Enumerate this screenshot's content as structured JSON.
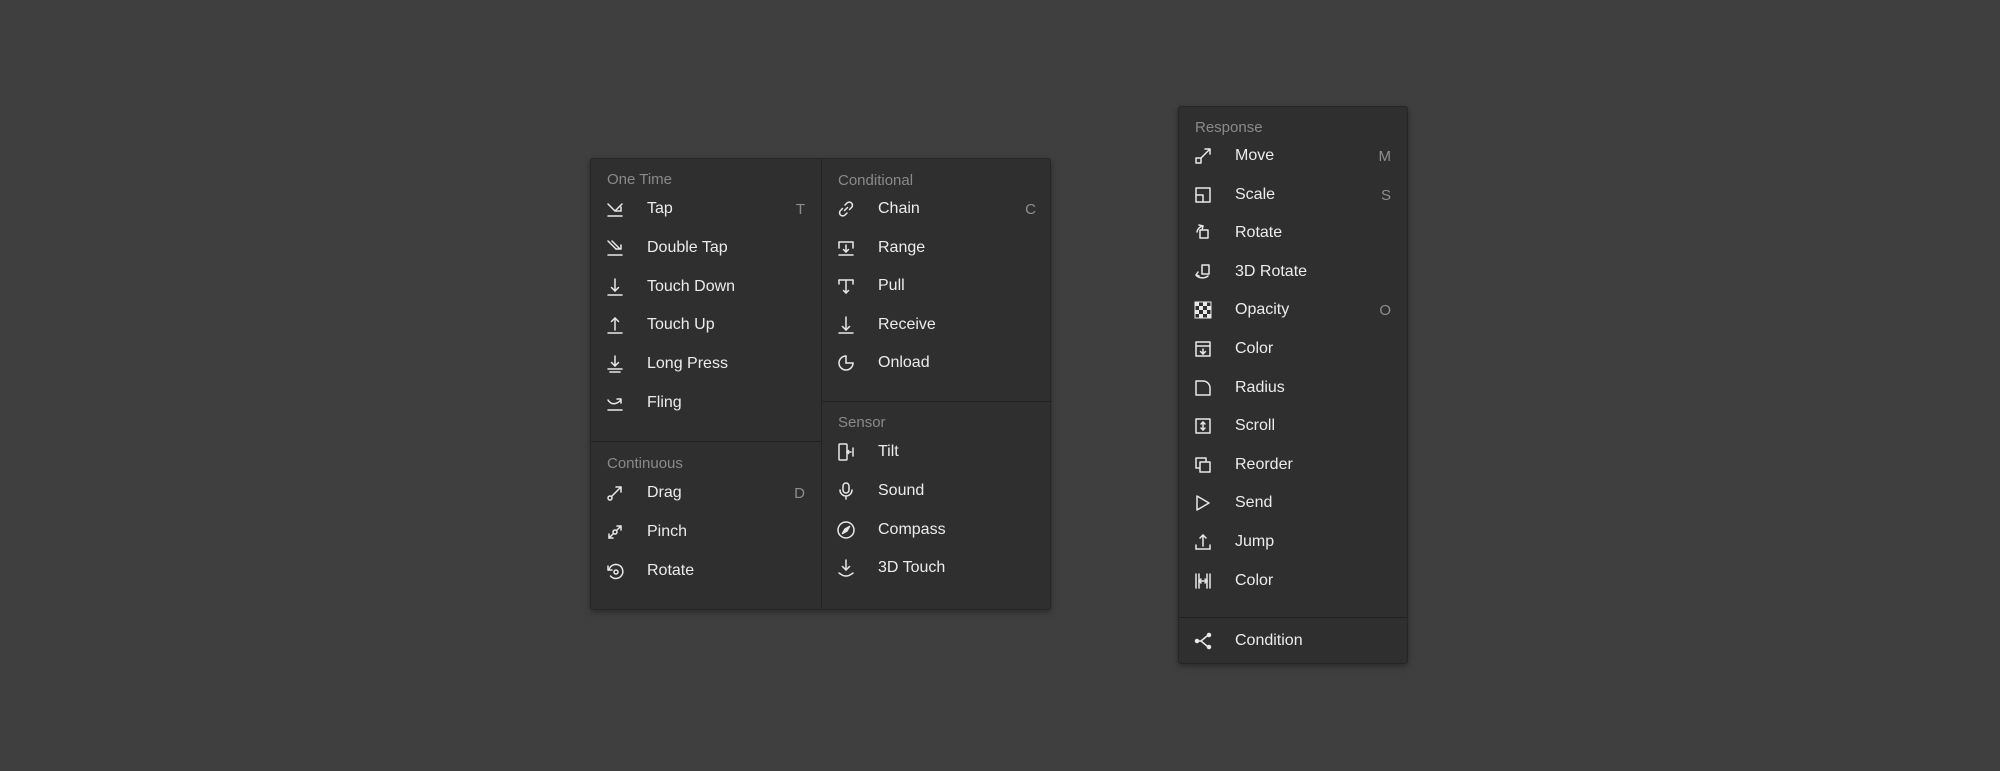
{
  "trigger_panel": {
    "one_time": {
      "title": "One Time",
      "items": [
        {
          "label": "Tap",
          "shortcut": "T",
          "icon": "tap-icon"
        },
        {
          "label": "Double Tap",
          "shortcut": "",
          "icon": "double-tap-icon"
        },
        {
          "label": "Touch Down",
          "shortcut": "",
          "icon": "touch-down-icon"
        },
        {
          "label": "Touch Up",
          "shortcut": "",
          "icon": "touch-up-icon"
        },
        {
          "label": "Long Press",
          "shortcut": "",
          "icon": "long-press-icon"
        },
        {
          "label": "Fling",
          "shortcut": "",
          "icon": "fling-icon"
        }
      ]
    },
    "continuous": {
      "title": "Continuous",
      "items": [
        {
          "label": "Drag",
          "shortcut": "D",
          "icon": "drag-icon"
        },
        {
          "label": "Pinch",
          "shortcut": "",
          "icon": "pinch-icon"
        },
        {
          "label": "Rotate",
          "shortcut": "",
          "icon": "rotate-gesture-icon"
        }
      ]
    },
    "conditional": {
      "title": "Conditional",
      "items": [
        {
          "label": "Chain",
          "shortcut": "C",
          "icon": "chain-icon"
        },
        {
          "label": "Range",
          "shortcut": "",
          "icon": "range-icon"
        },
        {
          "label": "Pull",
          "shortcut": "",
          "icon": "pull-icon"
        },
        {
          "label": "Receive",
          "shortcut": "",
          "icon": "receive-icon"
        },
        {
          "label": "Onload",
          "shortcut": "",
          "icon": "onload-icon"
        }
      ]
    },
    "sensor": {
      "title": "Sensor",
      "items": [
        {
          "label": "Tilt",
          "shortcut": "",
          "icon": "tilt-icon"
        },
        {
          "label": "Sound",
          "shortcut": "",
          "icon": "microphone-icon"
        },
        {
          "label": "Compass",
          "shortcut": "",
          "icon": "compass-icon"
        },
        {
          "label": "3D Touch",
          "shortcut": "",
          "icon": "3d-touch-icon"
        }
      ]
    }
  },
  "response_panel": {
    "response": {
      "title": "Response",
      "items": [
        {
          "label": "Move",
          "shortcut": "M",
          "icon": "move-icon"
        },
        {
          "label": "Scale",
          "shortcut": "S",
          "icon": "scale-icon"
        },
        {
          "label": "Rotate",
          "shortcut": "",
          "icon": "rotate-icon"
        },
        {
          "label": "3D Rotate",
          "shortcut": "",
          "icon": "3d-rotate-icon"
        },
        {
          "label": "Opacity",
          "shortcut": "O",
          "icon": "opacity-icon"
        },
        {
          "label": "Color",
          "shortcut": "",
          "icon": "color-fill-icon"
        },
        {
          "label": "Radius",
          "shortcut": "",
          "icon": "radius-icon"
        },
        {
          "label": "Scroll",
          "shortcut": "",
          "icon": "scroll-icon"
        },
        {
          "label": "Reorder",
          "shortcut": "",
          "icon": "reorder-icon"
        },
        {
          "label": "Send",
          "shortcut": "",
          "icon": "send-icon"
        },
        {
          "label": "Jump",
          "shortcut": "",
          "icon": "jump-icon"
        },
        {
          "label": "Color",
          "shortcut": "",
          "icon": "color-range-icon"
        }
      ]
    },
    "footer": {
      "items": [
        {
          "label": "Condition",
          "shortcut": "",
          "icon": "condition-icon"
        }
      ]
    }
  },
  "colors": {
    "background": "#3f3f3f",
    "panel": "#2f2f2f",
    "separator": "#222222",
    "section_title": "#8a8a8a",
    "label": "#ececec",
    "shortcut": "#8e8e8e"
  }
}
